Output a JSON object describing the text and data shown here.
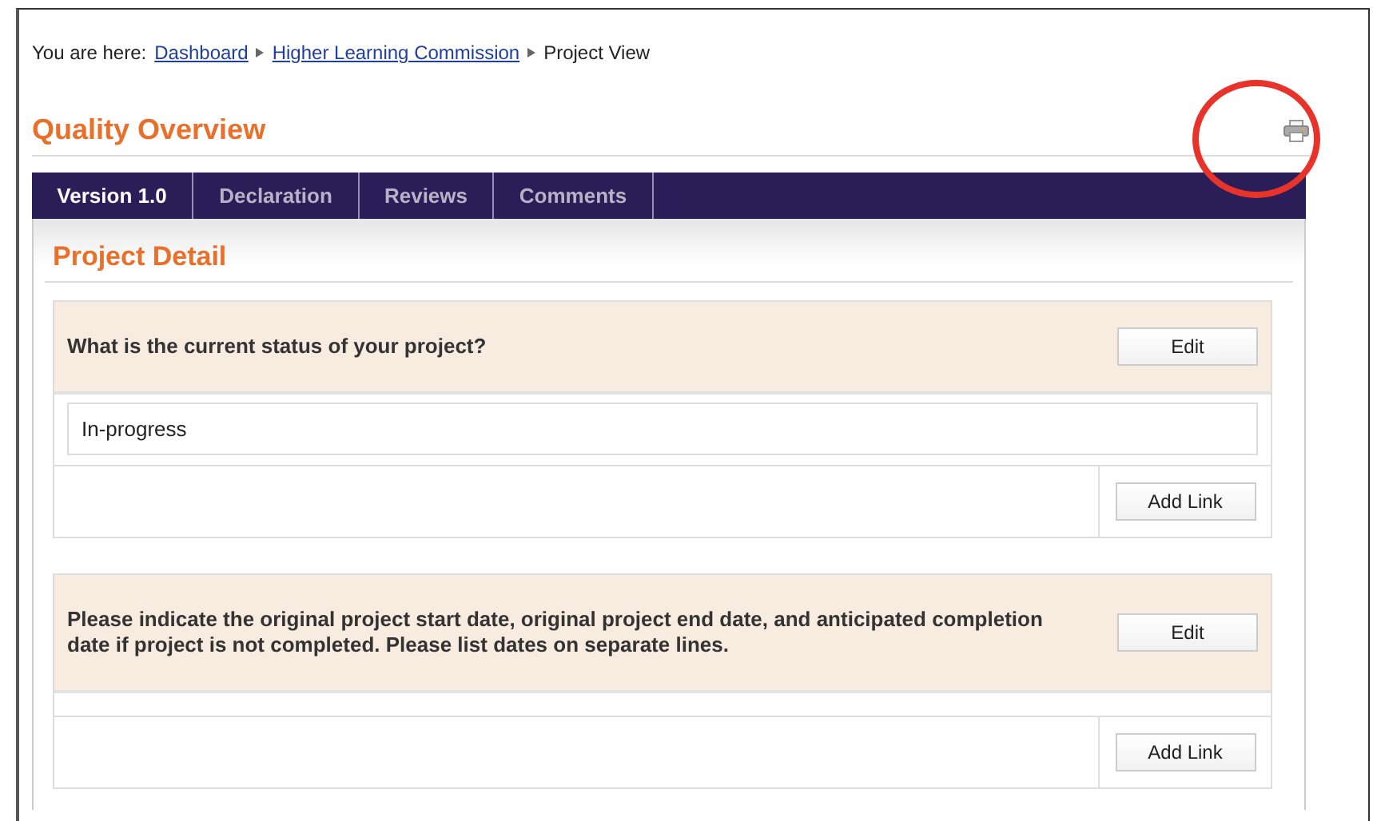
{
  "breadcrumb": {
    "label": "You are here:",
    "links": [
      "Dashboard",
      "Higher Learning Commission"
    ],
    "current": "Project View"
  },
  "page_title": "Quality Overview",
  "tabs": [
    {
      "label": "Version 1.0",
      "selected": true
    },
    {
      "label": "Declaration",
      "selected": false
    },
    {
      "label": "Reviews",
      "selected": false
    },
    {
      "label": "Comments",
      "selected": false
    }
  ],
  "section_title": "Project Detail",
  "questions": [
    {
      "question": "What is the current status of your project?",
      "answer": "In-progress",
      "edit_button": "Edit",
      "link_button": "Add Link"
    },
    {
      "question": "Please indicate the original project start date, original project end date, and anticipated completion date if project is not completed. Please list dates on separate lines.",
      "edit_button": "Edit",
      "link_button": "Add Link"
    }
  ]
}
